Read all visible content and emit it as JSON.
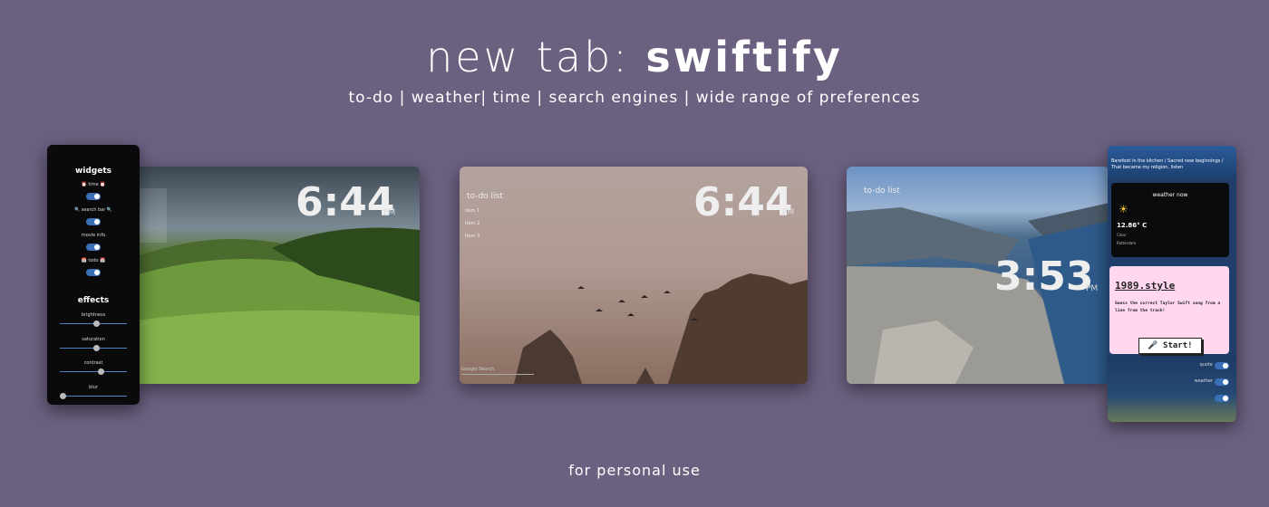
{
  "header": {
    "title_light": "new tab:",
    "title_bold": "swiftify",
    "subtitle": "to-do | weather| time | search engines | wide range of preferences"
  },
  "footer": {
    "text": "for personal use"
  },
  "shot1": {
    "time": "6:44",
    "ampm": "PM"
  },
  "shot2": {
    "time": "6:44",
    "ampm": "PM",
    "todo_title": "to-do list",
    "items": [
      "Item 1",
      "Item 2",
      "Item 3"
    ],
    "search_placeholder": "Google Search"
  },
  "shot3": {
    "time": "3:53",
    "ampm": "PM",
    "todo_title": "to-do list"
  },
  "settings_panel": {
    "widgets_title": "widgets",
    "widgets": [
      "⏰ time ⏰",
      "🔍 search bar 🔍",
      "movie info",
      "📅 todo 📅"
    ],
    "effects_title": "effects",
    "effects": [
      {
        "label": "brightness",
        "value": 0.5
      },
      {
        "label": "saturation",
        "value": 0.5
      },
      {
        "label": "contrast",
        "value": 0.57
      },
      {
        "label": "blur",
        "value": 0.0
      }
    ]
  },
  "phone_panel": {
    "quote": "Barefoot in the kitchen / Sacred new beginnings / That became my religion, listen",
    "weather": {
      "title": "weather now",
      "temp": "12.86° C",
      "condition": "Clear",
      "location": "Rotterdam"
    },
    "game": {
      "title": "1989.style",
      "description": "Guess the correct Taylor Swift song from a line from the track!",
      "button": "🎤 Start!"
    },
    "toggles": [
      "quote",
      "weather",
      ""
    ]
  }
}
